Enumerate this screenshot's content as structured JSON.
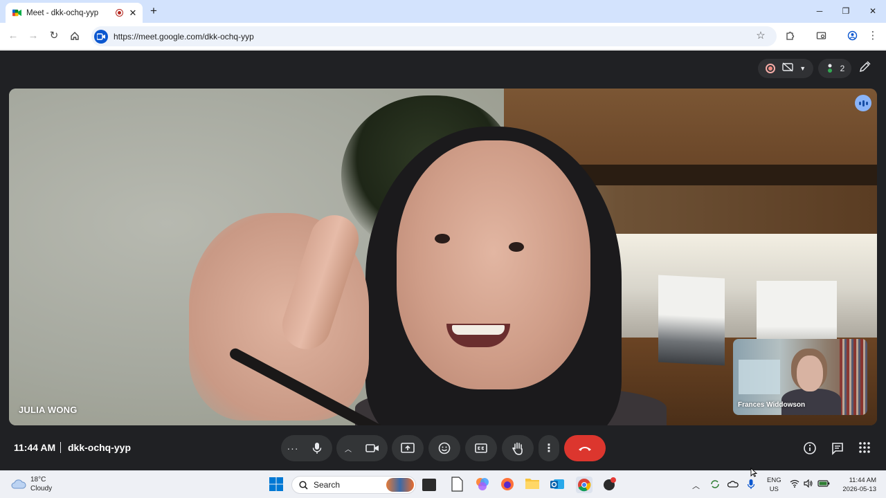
{
  "browser": {
    "tab_title": "Meet - dkk-ochq-yyp",
    "url": "https://meet.google.com/dkk-ochq-yyp"
  },
  "meet": {
    "main_participant": "JULIA WONG",
    "pip_participant": "Frances Widdowson",
    "participant_count": "2",
    "meeting_time": "11:44 AM",
    "meeting_code": "dkk-ochq-yyp",
    "controls": [
      "more-options",
      "microphone",
      "camera-options",
      "camera",
      "present-screen",
      "reactions",
      "captions",
      "raise-hand",
      "more-actions",
      "leave-call"
    ],
    "colors": {
      "background": "#202124",
      "control": "#333537",
      "end_call": "#dc362e",
      "accent": "#8ab4f8"
    }
  },
  "taskbar": {
    "weather_temp": "18°C",
    "weather_desc": "Cloudy",
    "search_label": "Search",
    "lang_top": "ENG",
    "lang_bottom": "US",
    "time": "11:44 AM",
    "date": "2026-05-13"
  }
}
